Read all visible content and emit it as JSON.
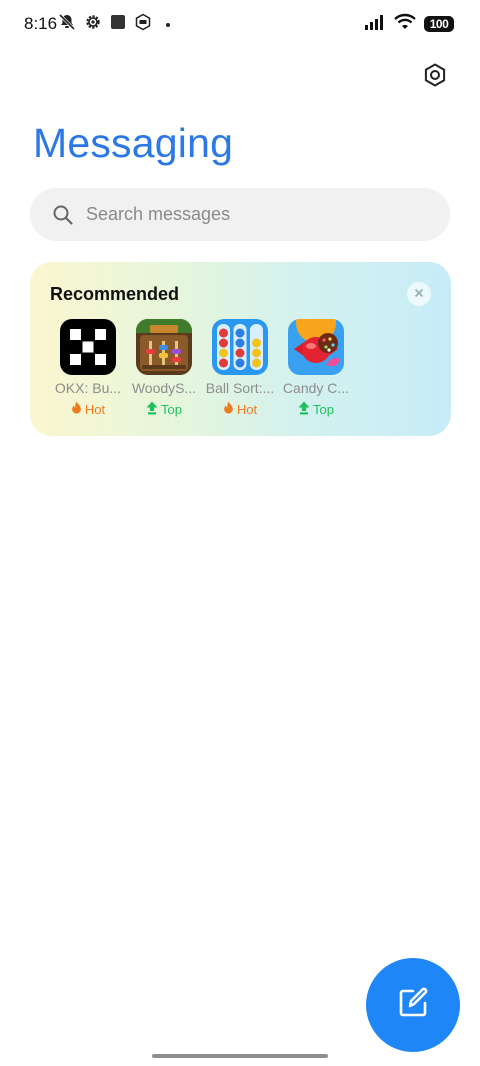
{
  "status_bar": {
    "time": "8:16",
    "battery": "100",
    "left_icons": [
      "bell-off-icon",
      "settings-gear-icon",
      "square-app-icon",
      "badge-icon"
    ],
    "right_icons": [
      "signal-icon",
      "wifi-icon",
      "battery-icon"
    ]
  },
  "header": {
    "title": "Messaging",
    "settings_icon": "settings-hexagon-icon"
  },
  "search": {
    "placeholder": "Search messages"
  },
  "recommended": {
    "title": "Recommended",
    "apps": [
      {
        "name": "OKX: Bu...",
        "badge": "Hot",
        "badge_type": "hot",
        "icon": "okx-app-icon"
      },
      {
        "name": "WoodyS...",
        "badge": "Top",
        "badge_type": "top",
        "icon": "woody-app-icon"
      },
      {
        "name": "Ball Sort:...",
        "badge": "Hot",
        "badge_type": "hot",
        "icon": "ball-sort-app-icon"
      },
      {
        "name": "Candy C...",
        "badge": "Top",
        "badge_type": "top",
        "icon": "candy-crush-app-icon"
      }
    ]
  },
  "fab": {
    "icon": "compose-icon"
  },
  "colors": {
    "accent": "#2b78e6",
    "fab": "#1f86f7",
    "hot": "#f07b1f",
    "top": "#1fbf5d"
  }
}
